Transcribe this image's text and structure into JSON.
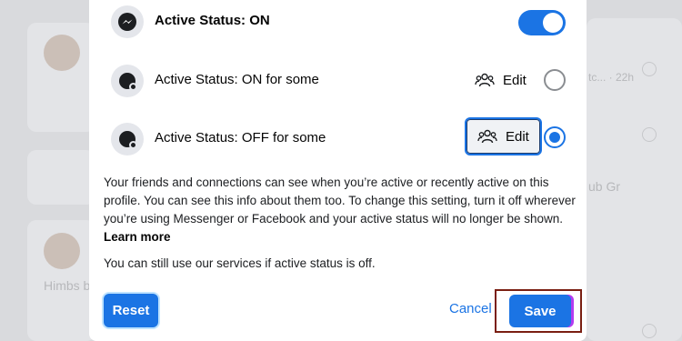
{
  "background": {
    "snippet_1": "tc... · 22h",
    "snippet_2": "ub Gr",
    "snippet_3": "Himbs b"
  },
  "dialog": {
    "rows": [
      {
        "label": "Active Status: ON",
        "icon": "messenger-icon",
        "control": "toggle",
        "toggle_on": true
      },
      {
        "label": "Active Status: ON for some",
        "icon": "status-icon",
        "edit_label": "Edit",
        "selected": false
      },
      {
        "label": "Active Status: OFF for some",
        "icon": "status-icon",
        "edit_label": "Edit",
        "selected": true
      }
    ],
    "description": "Your friends and connections can see when you’re active or recently active on this profile. You can see this info about them too. To change this setting, turn it off wherever you’re using Messenger or Facebook and your active status will no longer be shown.",
    "learn_more": "Learn more",
    "note": "You can still use our services if active status is off.",
    "buttons": {
      "reset": "Reset",
      "cancel": "Cancel",
      "save": "Save"
    }
  },
  "colors": {
    "accent": "#1b74e4",
    "text": "#050505"
  }
}
